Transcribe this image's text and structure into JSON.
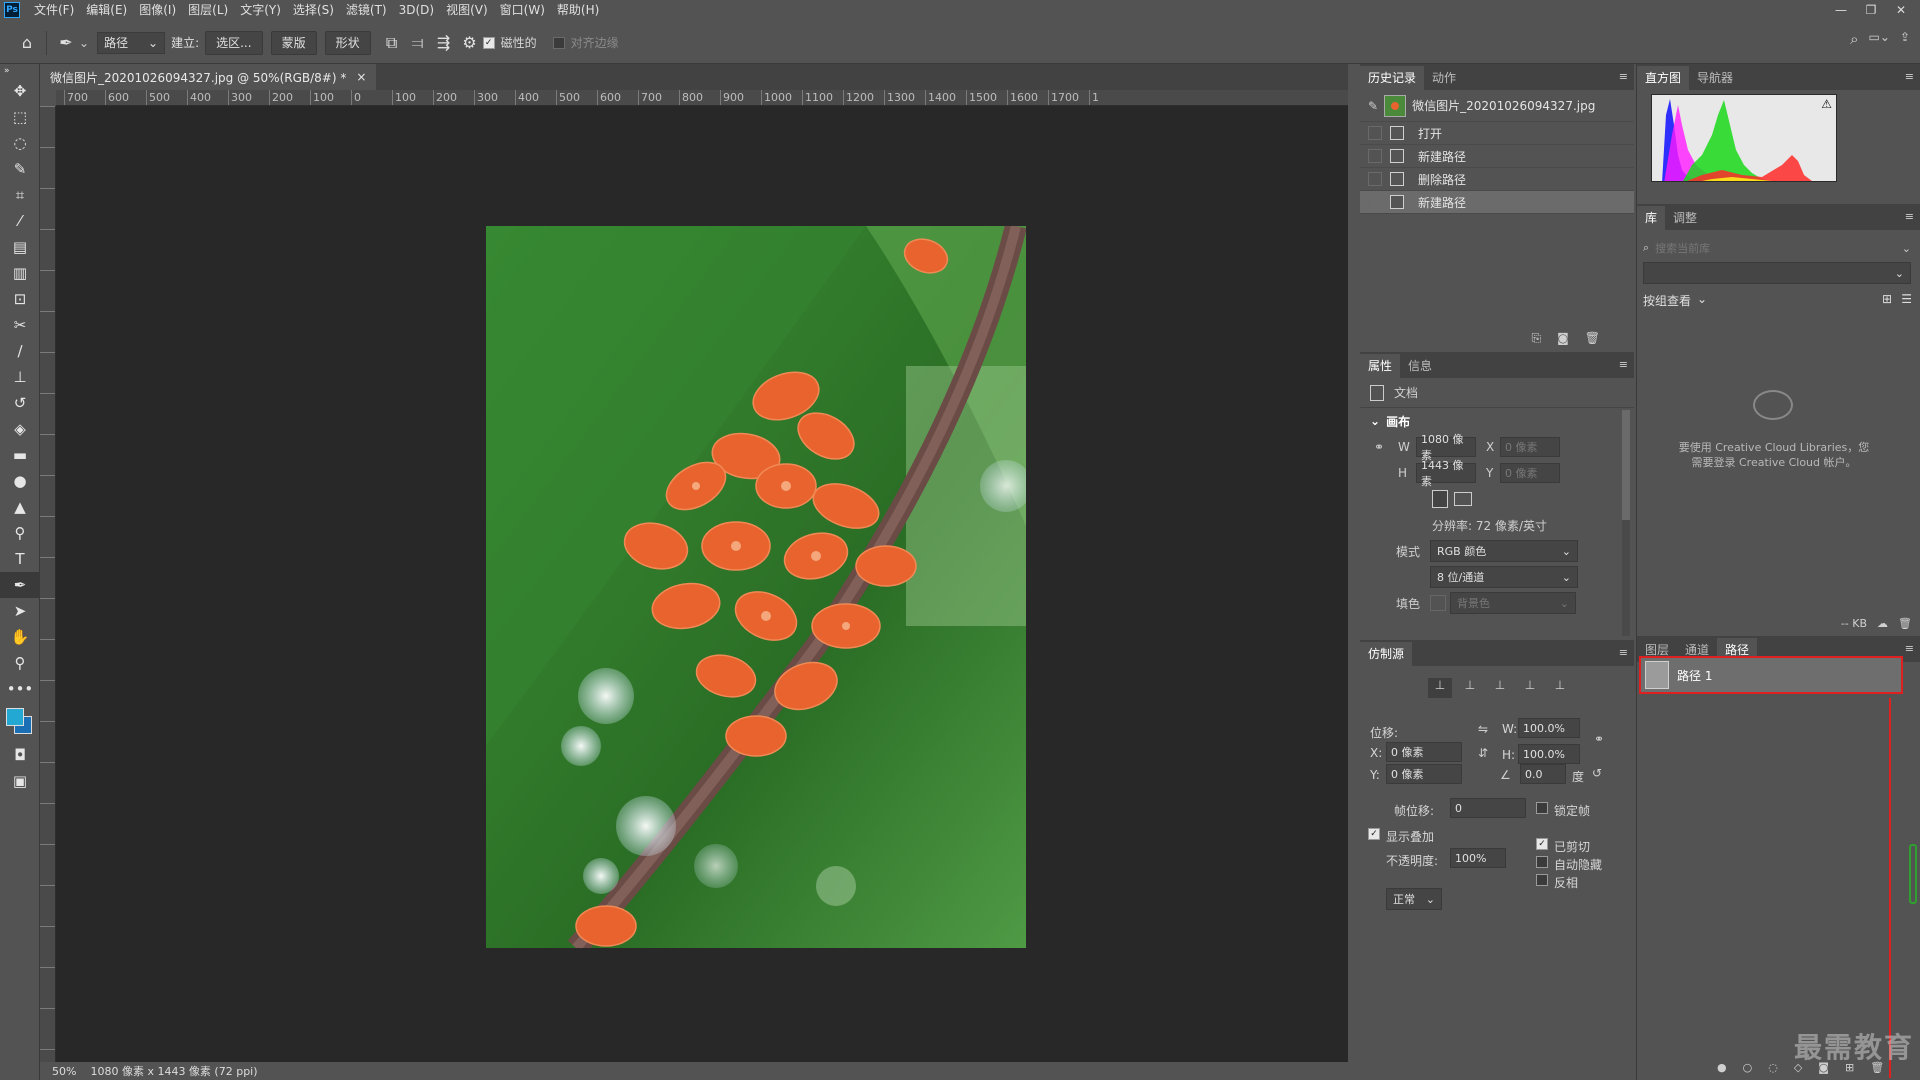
{
  "menu": [
    "文件(F)",
    "编辑(E)",
    "图像(I)",
    "图层(L)",
    "文字(Y)",
    "选择(S)",
    "滤镜(T)",
    "3D(D)",
    "视图(V)",
    "窗口(W)",
    "帮助(H)"
  ],
  "app_logo": "Ps",
  "options": {
    "tool_mode": "路径",
    "make_label": "建立:",
    "selection_btn": "选区...",
    "mask_btn": "蒙版",
    "shape_btn": "形状",
    "magnetic_label": "磁性的",
    "align_edges_label": "对齐边缘"
  },
  "document": {
    "tab_title": "微信图片_20201026094327.jpg @ 50%(RGB/8#) *",
    "close": "×",
    "zoom": "50%",
    "size_info": "1080 像素 x 1443 像素 (72 ppi)",
    "ruler_labels": [
      "700",
      "600",
      "500",
      "400",
      "300",
      "200",
      "100",
      "0",
      "100",
      "200",
      "300",
      "400",
      "500",
      "600",
      "700",
      "800",
      "900",
      "1000",
      "1100",
      "1200",
      "1300",
      "1400",
      "1500",
      "1600",
      "1700",
      "1"
    ]
  },
  "history": {
    "tabs": [
      "历史记录",
      "动作"
    ],
    "snapshot_name": "微信图片_20201026094327.jpg",
    "states": [
      "打开",
      "新建路径",
      "删除路径",
      "新建路径"
    ]
  },
  "properties": {
    "tabs": [
      "属性",
      "信息"
    ],
    "doc_label": "文档",
    "section": "画布",
    "w_label": "W",
    "w_value": "1080 像素",
    "h_label": "H",
    "h_value": "1443 像素",
    "x_label": "X",
    "x_placeholder": "0 像素",
    "y_label": "Y",
    "y_placeholder": "0 像素",
    "resolution": "分辨率: 72 像素/英寸",
    "mode_label": "模式",
    "mode_value": "RGB 颜色",
    "depth_value": "8 位/通道",
    "fill_label": "填色",
    "fill_value": "背景色"
  },
  "clone": {
    "title": "仿制源",
    "offset_label": "位移:",
    "w_label": "W:",
    "w_value": "100.0%",
    "h_label": "H:",
    "h_value": "100.0%",
    "x_label": "X:",
    "x_value": "0 像素",
    "y_label": "Y:",
    "y_value": "0 像素",
    "angle_value": "0.0",
    "degree": "度",
    "frame_offset_label": "帧位移:",
    "frame_offset_value": "0",
    "lock_frame": "锁定帧",
    "show_overlay": "显示叠加",
    "opacity_label": "不透明度:",
    "opacity_value": "100%",
    "clipped": "已剪切",
    "auto_hide": "自动隐藏",
    "invert": "反相",
    "blend_mode": "正常"
  },
  "histogram_panel": {
    "tabs": [
      "直方图",
      "导航器"
    ]
  },
  "libraries": {
    "tabs": [
      "库",
      "调整"
    ],
    "search_placeholder": "搜索当前库",
    "group_view": "按组查看",
    "message_line1": "要使用 Creative Cloud Libraries，您",
    "message_line2": "需要登录 Creative Cloud 帐户。",
    "kb": "-- KB"
  },
  "layers_panel": {
    "tabs": [
      "图层",
      "通道",
      "路径"
    ],
    "path_name": "路径 1"
  },
  "watermark": "最需教育"
}
